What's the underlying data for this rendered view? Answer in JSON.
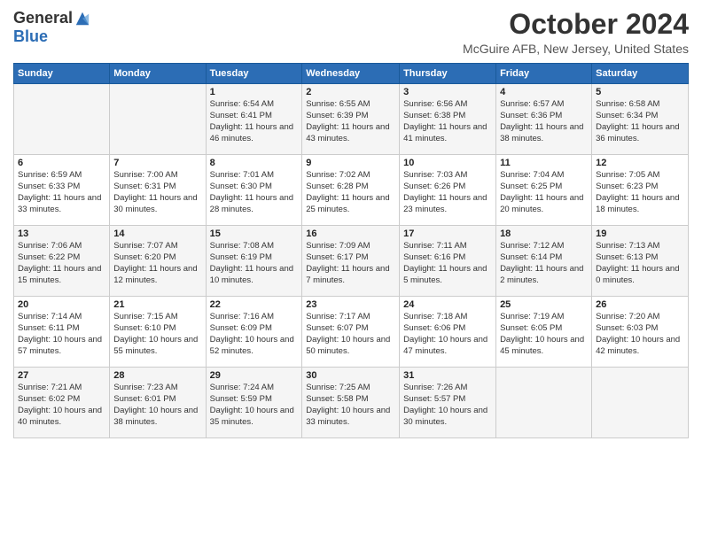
{
  "header": {
    "logo_general": "General",
    "logo_blue": "Blue",
    "title": "October 2024",
    "subtitle": "McGuire AFB, New Jersey, United States"
  },
  "days_of_week": [
    "Sunday",
    "Monday",
    "Tuesday",
    "Wednesday",
    "Thursday",
    "Friday",
    "Saturday"
  ],
  "weeks": [
    [
      {
        "day": "",
        "info": ""
      },
      {
        "day": "",
        "info": ""
      },
      {
        "day": "1",
        "info": "Sunrise: 6:54 AM\nSunset: 6:41 PM\nDaylight: 11 hours and 46 minutes."
      },
      {
        "day": "2",
        "info": "Sunrise: 6:55 AM\nSunset: 6:39 PM\nDaylight: 11 hours and 43 minutes."
      },
      {
        "day": "3",
        "info": "Sunrise: 6:56 AM\nSunset: 6:38 PM\nDaylight: 11 hours and 41 minutes."
      },
      {
        "day": "4",
        "info": "Sunrise: 6:57 AM\nSunset: 6:36 PM\nDaylight: 11 hours and 38 minutes."
      },
      {
        "day": "5",
        "info": "Sunrise: 6:58 AM\nSunset: 6:34 PM\nDaylight: 11 hours and 36 minutes."
      }
    ],
    [
      {
        "day": "6",
        "info": "Sunrise: 6:59 AM\nSunset: 6:33 PM\nDaylight: 11 hours and 33 minutes."
      },
      {
        "day": "7",
        "info": "Sunrise: 7:00 AM\nSunset: 6:31 PM\nDaylight: 11 hours and 30 minutes."
      },
      {
        "day": "8",
        "info": "Sunrise: 7:01 AM\nSunset: 6:30 PM\nDaylight: 11 hours and 28 minutes."
      },
      {
        "day": "9",
        "info": "Sunrise: 7:02 AM\nSunset: 6:28 PM\nDaylight: 11 hours and 25 minutes."
      },
      {
        "day": "10",
        "info": "Sunrise: 7:03 AM\nSunset: 6:26 PM\nDaylight: 11 hours and 23 minutes."
      },
      {
        "day": "11",
        "info": "Sunrise: 7:04 AM\nSunset: 6:25 PM\nDaylight: 11 hours and 20 minutes."
      },
      {
        "day": "12",
        "info": "Sunrise: 7:05 AM\nSunset: 6:23 PM\nDaylight: 11 hours and 18 minutes."
      }
    ],
    [
      {
        "day": "13",
        "info": "Sunrise: 7:06 AM\nSunset: 6:22 PM\nDaylight: 11 hours and 15 minutes."
      },
      {
        "day": "14",
        "info": "Sunrise: 7:07 AM\nSunset: 6:20 PM\nDaylight: 11 hours and 12 minutes."
      },
      {
        "day": "15",
        "info": "Sunrise: 7:08 AM\nSunset: 6:19 PM\nDaylight: 11 hours and 10 minutes."
      },
      {
        "day": "16",
        "info": "Sunrise: 7:09 AM\nSunset: 6:17 PM\nDaylight: 11 hours and 7 minutes."
      },
      {
        "day": "17",
        "info": "Sunrise: 7:11 AM\nSunset: 6:16 PM\nDaylight: 11 hours and 5 minutes."
      },
      {
        "day": "18",
        "info": "Sunrise: 7:12 AM\nSunset: 6:14 PM\nDaylight: 11 hours and 2 minutes."
      },
      {
        "day": "19",
        "info": "Sunrise: 7:13 AM\nSunset: 6:13 PM\nDaylight: 11 hours and 0 minutes."
      }
    ],
    [
      {
        "day": "20",
        "info": "Sunrise: 7:14 AM\nSunset: 6:11 PM\nDaylight: 10 hours and 57 minutes."
      },
      {
        "day": "21",
        "info": "Sunrise: 7:15 AM\nSunset: 6:10 PM\nDaylight: 10 hours and 55 minutes."
      },
      {
        "day": "22",
        "info": "Sunrise: 7:16 AM\nSunset: 6:09 PM\nDaylight: 10 hours and 52 minutes."
      },
      {
        "day": "23",
        "info": "Sunrise: 7:17 AM\nSunset: 6:07 PM\nDaylight: 10 hours and 50 minutes."
      },
      {
        "day": "24",
        "info": "Sunrise: 7:18 AM\nSunset: 6:06 PM\nDaylight: 10 hours and 47 minutes."
      },
      {
        "day": "25",
        "info": "Sunrise: 7:19 AM\nSunset: 6:05 PM\nDaylight: 10 hours and 45 minutes."
      },
      {
        "day": "26",
        "info": "Sunrise: 7:20 AM\nSunset: 6:03 PM\nDaylight: 10 hours and 42 minutes."
      }
    ],
    [
      {
        "day": "27",
        "info": "Sunrise: 7:21 AM\nSunset: 6:02 PM\nDaylight: 10 hours and 40 minutes."
      },
      {
        "day": "28",
        "info": "Sunrise: 7:23 AM\nSunset: 6:01 PM\nDaylight: 10 hours and 38 minutes."
      },
      {
        "day": "29",
        "info": "Sunrise: 7:24 AM\nSunset: 5:59 PM\nDaylight: 10 hours and 35 minutes."
      },
      {
        "day": "30",
        "info": "Sunrise: 7:25 AM\nSunset: 5:58 PM\nDaylight: 10 hours and 33 minutes."
      },
      {
        "day": "31",
        "info": "Sunrise: 7:26 AM\nSunset: 5:57 PM\nDaylight: 10 hours and 30 minutes."
      },
      {
        "day": "",
        "info": ""
      },
      {
        "day": "",
        "info": ""
      }
    ]
  ]
}
